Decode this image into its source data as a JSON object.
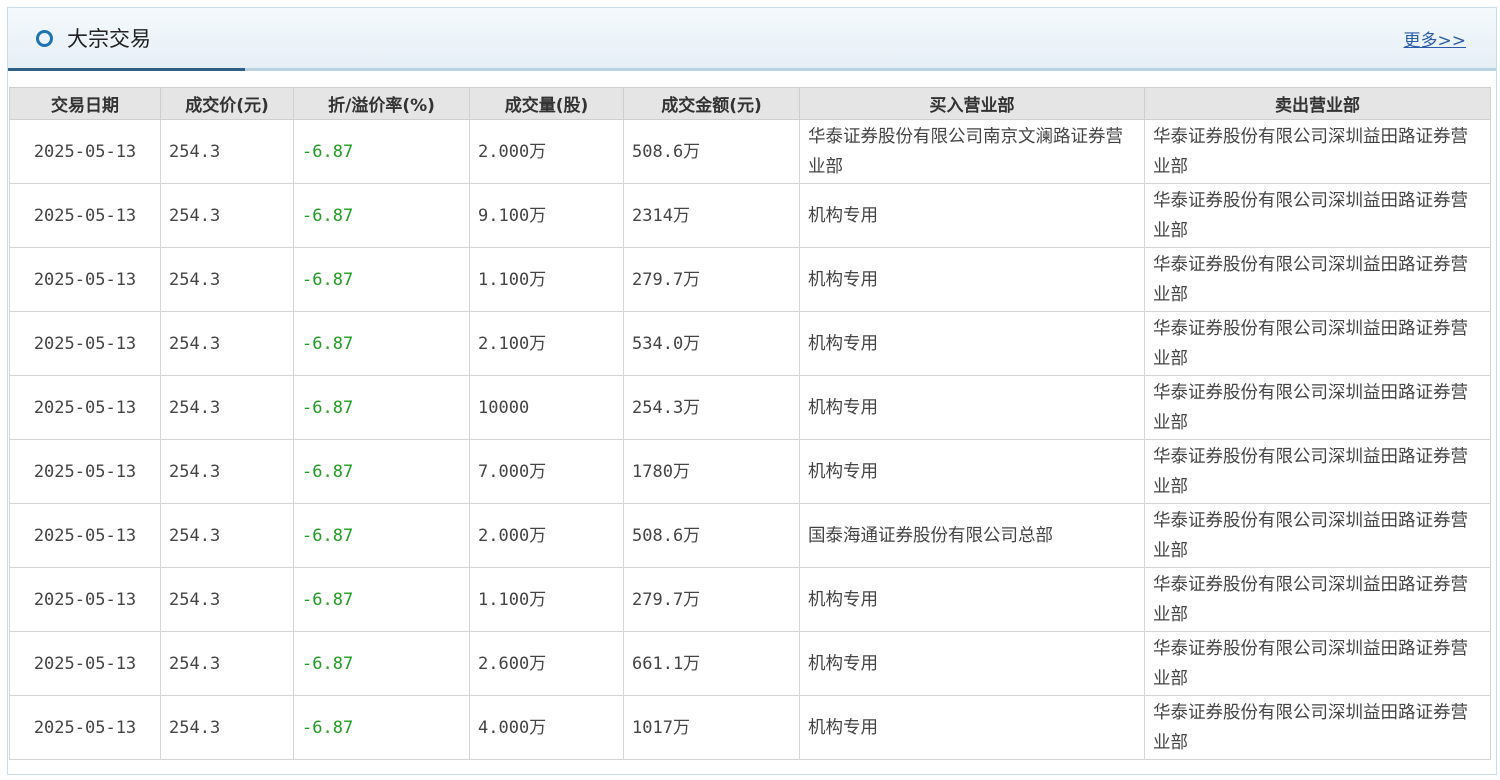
{
  "header": {
    "title": "大宗交易",
    "more_label": "更多>>"
  },
  "colors": {
    "accent": "#2d5f87",
    "icon": "#1e73b6",
    "negative": "#1f9b1f",
    "link": "#2a5caa"
  },
  "table": {
    "columns": [
      "交易日期",
      "成交价(元)",
      "折/溢价率(%)",
      "成交量(股)",
      "成交金额(元)",
      "买入营业部",
      "卖出营业部"
    ],
    "rows": [
      {
        "date": "2025-05-13",
        "price": "254.3",
        "rate": "-6.87",
        "volume": "2.000万",
        "amount": "508.6万",
        "buyer": "华泰证券股份有限公司南京文澜路证券营业部",
        "seller": "华泰证券股份有限公司深圳益田路证券营业部"
      },
      {
        "date": "2025-05-13",
        "price": "254.3",
        "rate": "-6.87",
        "volume": "9.100万",
        "amount": "2314万",
        "buyer": "机构专用",
        "seller": "华泰证券股份有限公司深圳益田路证券营业部"
      },
      {
        "date": "2025-05-13",
        "price": "254.3",
        "rate": "-6.87",
        "volume": "1.100万",
        "amount": "279.7万",
        "buyer": "机构专用",
        "seller": "华泰证券股份有限公司深圳益田路证券营业部"
      },
      {
        "date": "2025-05-13",
        "price": "254.3",
        "rate": "-6.87",
        "volume": "2.100万",
        "amount": "534.0万",
        "buyer": "机构专用",
        "seller": "华泰证券股份有限公司深圳益田路证券营业部"
      },
      {
        "date": "2025-05-13",
        "price": "254.3",
        "rate": "-6.87",
        "volume": "10000",
        "amount": "254.3万",
        "buyer": "机构专用",
        "seller": "华泰证券股份有限公司深圳益田路证券营业部"
      },
      {
        "date": "2025-05-13",
        "price": "254.3",
        "rate": "-6.87",
        "volume": "7.000万",
        "amount": "1780万",
        "buyer": "机构专用",
        "seller": "华泰证券股份有限公司深圳益田路证券营业部"
      },
      {
        "date": "2025-05-13",
        "price": "254.3",
        "rate": "-6.87",
        "volume": "2.000万",
        "amount": "508.6万",
        "buyer": "国泰海通证券股份有限公司总部",
        "seller": "华泰证券股份有限公司深圳益田路证券营业部"
      },
      {
        "date": "2025-05-13",
        "price": "254.3",
        "rate": "-6.87",
        "volume": "1.100万",
        "amount": "279.7万",
        "buyer": "机构专用",
        "seller": "华泰证券股份有限公司深圳益田路证券营业部"
      },
      {
        "date": "2025-05-13",
        "price": "254.3",
        "rate": "-6.87",
        "volume": "2.600万",
        "amount": "661.1万",
        "buyer": "机构专用",
        "seller": "华泰证券股份有限公司深圳益田路证券营业部"
      },
      {
        "date": "2025-05-13",
        "price": "254.3",
        "rate": "-6.87",
        "volume": "4.000万",
        "amount": "1017万",
        "buyer": "机构专用",
        "seller": "华泰证券股份有限公司深圳益田路证券营业部"
      }
    ]
  }
}
